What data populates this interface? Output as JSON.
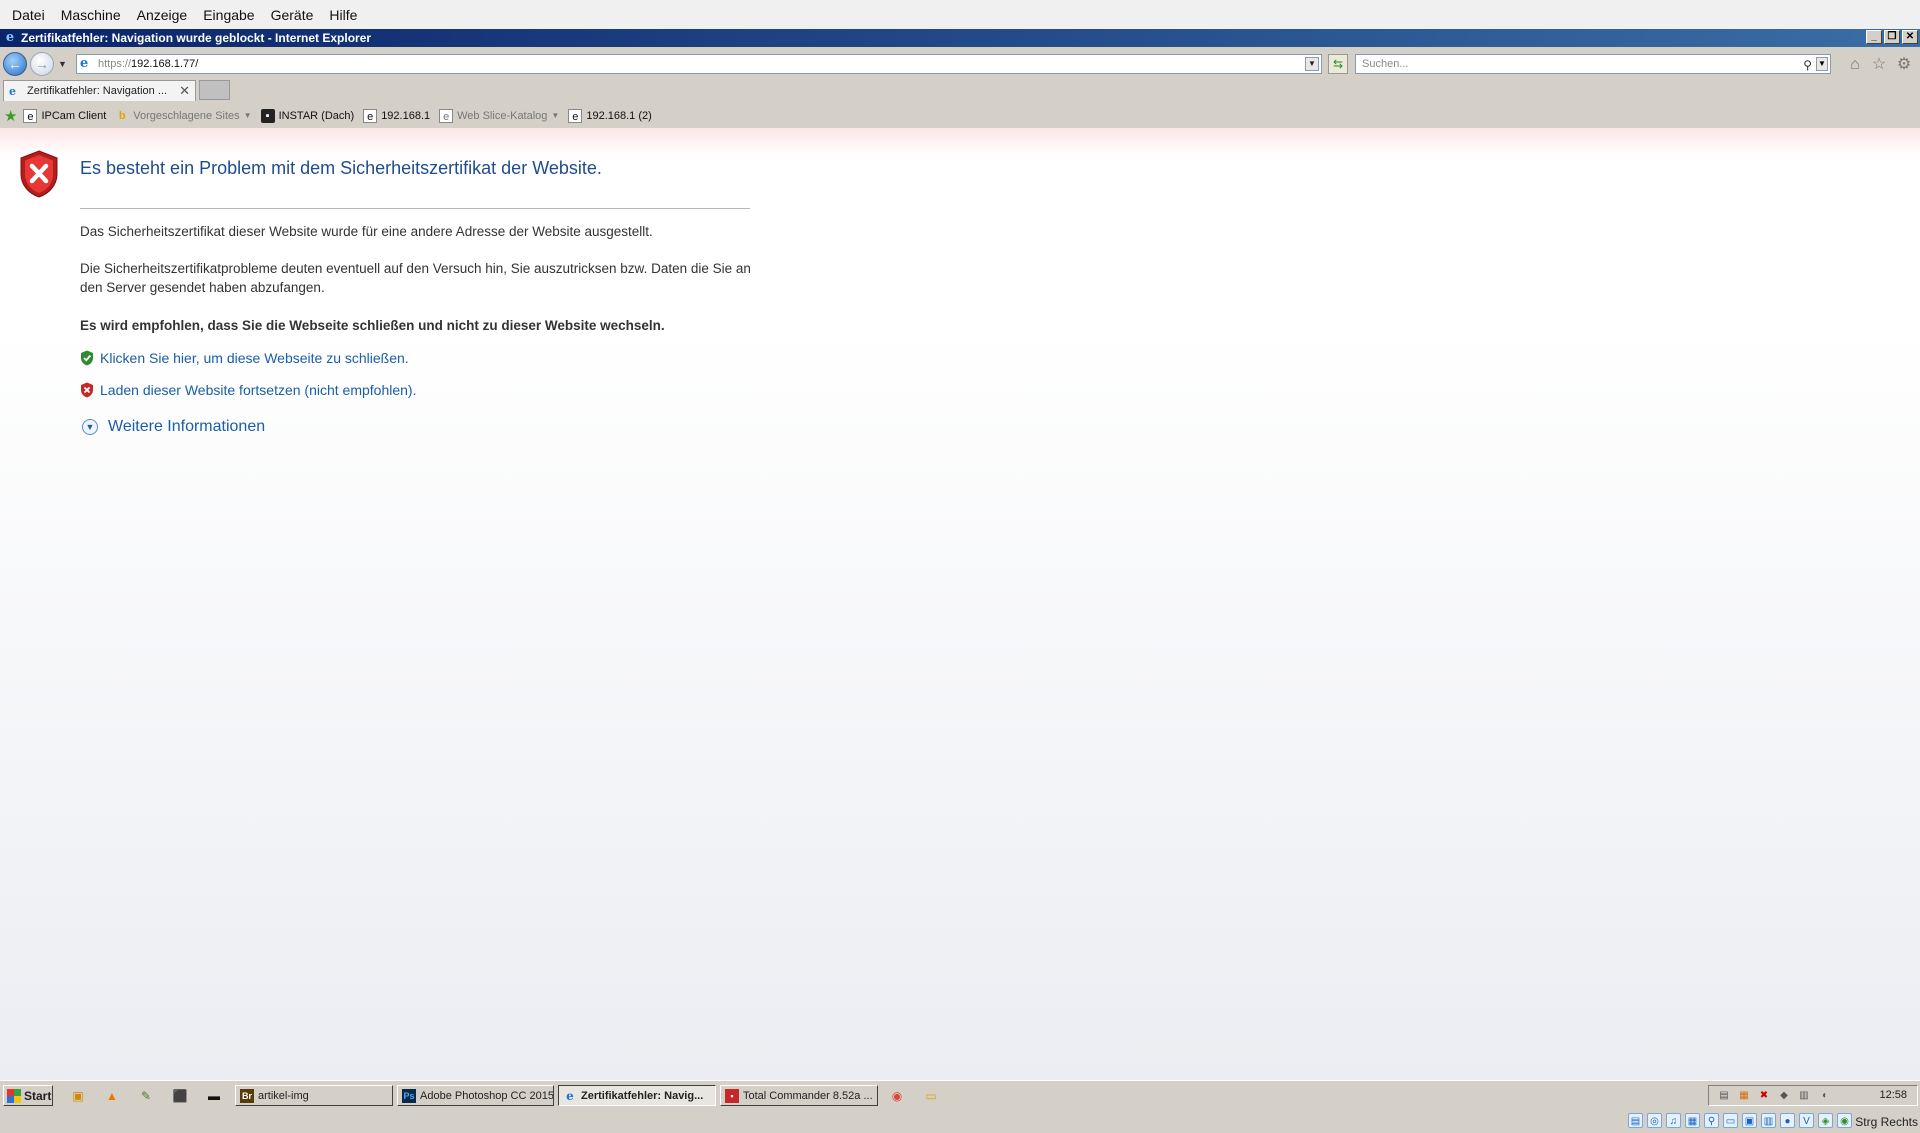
{
  "vm_menu": [
    "Datei",
    "Maschine",
    "Anzeige",
    "Eingabe",
    "Geräte",
    "Hilfe"
  ],
  "window": {
    "title": "Zertifikatfehler: Navigation wurde geblockt - Internet Explorer"
  },
  "address": {
    "protocol": "https://",
    "host": "192.168.1.77/"
  },
  "search": {
    "placeholder": "Suchen..."
  },
  "tabs": [
    {
      "label": "Zertifikatfehler: Navigation ..."
    }
  ],
  "favorites": {
    "items": [
      {
        "label": "IPCam Client",
        "icon": "page-icon"
      },
      {
        "label": "Vorgeschlagene Sites",
        "icon": "bing-icon",
        "dropdown": true
      },
      {
        "label": "INSTAR (Dach)",
        "icon": "camera-icon"
      },
      {
        "label": "192.168.1",
        "icon": "page-icon"
      },
      {
        "label": "Web Slice-Katalog",
        "icon": "webslice-icon",
        "dropdown": true
      },
      {
        "label": "192.168.1 (2)",
        "icon": "page-icon"
      }
    ]
  },
  "content": {
    "title": "Es besteht ein Problem mit dem Sicherheitszertifikat der Website.",
    "para1": "Das Sicherheitszertifikat dieser Website wurde für eine andere Adresse der Website ausgestellt.",
    "para2": "Die Sicherheitszertifikatprobleme deuten eventuell auf den Versuch hin, Sie auszutricksen bzw. Daten die Sie an den Server gesendet haben abzufangen.",
    "recommendation": "Es wird empfohlen, dass Sie die Webseite schließen und nicht zu dieser Website wechseln.",
    "close_link": "Klicken Sie hier, um diese Webseite zu schließen.",
    "continue_link": "Laden dieser Website fortsetzen (nicht empfohlen).",
    "more_info": "Weitere Informationen"
  },
  "taskbar": {
    "start_label": "Start",
    "tasks": [
      {
        "label": "artikel-img",
        "icon": "bridge-icon",
        "active": false
      },
      {
        "label": "Adobe Photoshop CC 2015",
        "icon": "photoshop-icon",
        "active": false
      },
      {
        "label": "Zertifikatfehler: Navig...",
        "icon": "ie-icon",
        "active": true
      },
      {
        "label": "Total Commander 8.52a ...",
        "icon": "floppy-icon",
        "active": false
      }
    ],
    "clock": "12:58",
    "host_key": "Strg Rechts"
  },
  "colors": {
    "link": "#1a5ea8",
    "title": "#1f4c8c",
    "error_red": "#c62828",
    "ok_green": "#2e8b2e"
  }
}
